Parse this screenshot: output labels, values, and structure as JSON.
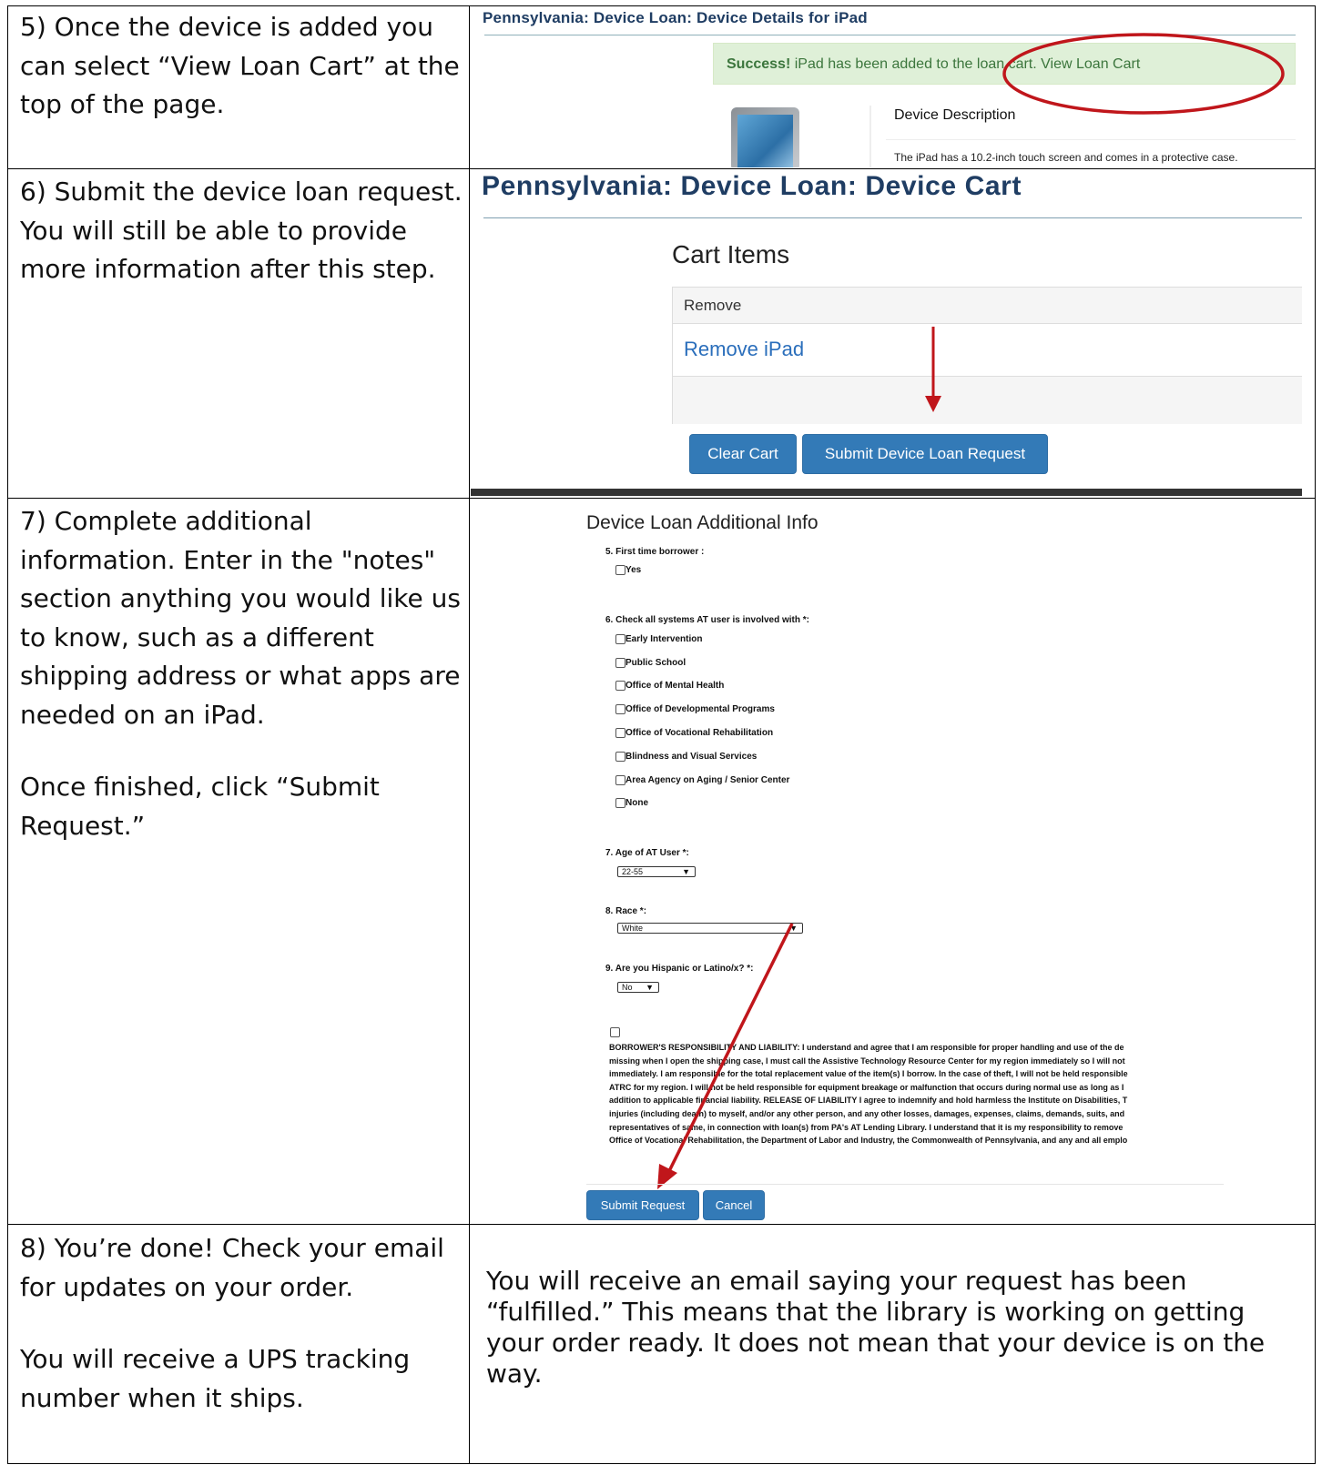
{
  "steps": [
    {
      "text": "5) Once the device is added you can select “View Loan Cart” at the top of the page."
    },
    {
      "text": "6) Submit the device loan request. You will still be able to provide more information after this step."
    },
    {
      "text_1": "7) Complete additional information. Enter in the \"notes\" section anything you would like us to know, such as a different shipping address or what apps are needed on an iPad.",
      "text_2": "Once finished, click “Submit Request.”"
    },
    {
      "text_1": "8) You’re done! Check your email for updates on your order.",
      "text_2": "You will receive a UPS tracking number when it ships."
    }
  ],
  "shot5": {
    "title": "Pennsylvania: Device Loan: Device Details for iPad",
    "success_strong": "Success!",
    "success_text": "iPad has been added to the loan cart.",
    "success_link": "View Loan Cart",
    "desc_heading": "Device Description",
    "desc_text": "The iPad has a 10.2-inch touch screen and comes in a protective case.",
    "annotation_color": "#c0161b"
  },
  "shot6": {
    "title": "Pennsylvania: Device Loan: Device Cart",
    "cart_heading": "Cart Items",
    "col_header": "Remove",
    "remove_link": "Remove iPad",
    "clear_button": "Clear Cart",
    "submit_button": "Submit Device Loan Request",
    "title_color": "#1f3d63",
    "button_color": "#337ab7"
  },
  "shot7": {
    "heading": "Device Loan Additional Info",
    "q5": {
      "label": "5. First time borrower :",
      "options": [
        "Yes"
      ]
    },
    "q6": {
      "label": "6. Check all systems AT user is involved with *:",
      "options": [
        "Early Intervention",
        "Public School",
        "Office of Mental Health",
        "Office of Developmental Programs",
        "Office of Vocational Rehabilitation",
        "Blindness and Visual Services",
        "Area Agency on Aging / Senior Center",
        "None"
      ]
    },
    "q7": {
      "label": "7. Age of AT User *:",
      "value": "22-55"
    },
    "q8": {
      "label": "8. Race *:",
      "value": "White"
    },
    "q9": {
      "label": "9. Are you Hispanic or Latino/x? *:",
      "value": "No"
    },
    "liability_lines": [
      "BORROWER'S RESPONSIBILITY AND LIABILITY: I understand and agree that I am responsible for proper handling and use of the de",
      "missing when I open the shipping case, I must call the Assistive Technology Resource Center for my region immediately so I will not",
      "immediately. I am responsible for the total replacement value of the item(s) I borrow. In the case of theft, I will not be held responsible",
      "ATRC for my region. I will not be held responsible for equipment breakage or malfunction that occurs during normal use as long as I",
      "addition to applicable financial liability. RELEASE OF LIABILITY I agree to indemnify and hold harmless the Institute on Disabilities, T",
      "injuries (including death) to myself, and/or any other person, and any other losses, damages, expenses, claims, demands, suits, and",
      "representatives of same, in connection with loan(s) from PA's AT Lending Library. I understand that it is my responsibility to remove",
      "Office of Vocational Rehabilitation, the Department of Labor and Industry, the Commonwealth of Pennsylvania, and any and all emplo"
    ],
    "submit_button": "Submit Request",
    "cancel_button": "Cancel"
  },
  "step8_right": "You will receive an email saying your request has been “fulfilled.” This means that the library is working on getting your order ready. It does not mean that your device is on the way."
}
